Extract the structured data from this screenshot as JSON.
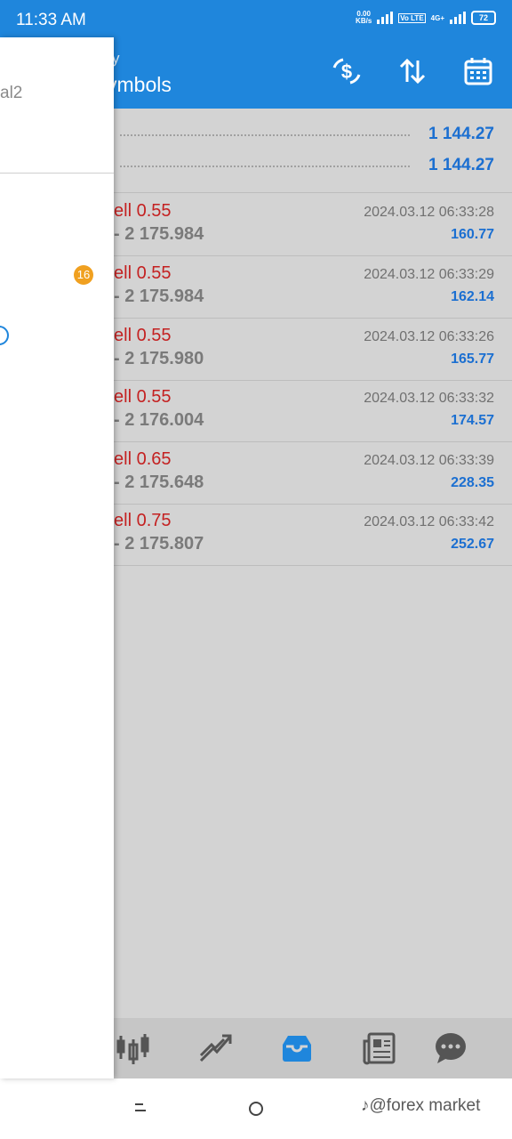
{
  "status_bar": {
    "time": "11:33 AM",
    "net_speed_top": "0.00",
    "net_speed_bottom": "KB/s",
    "network_label": "4G+",
    "volte_label": "Vo LTE",
    "battery": "72"
  },
  "header": {
    "subtitle_fragment": "y",
    "title_fragment": "ymbols",
    "icons": [
      "currency-exchange-icon",
      "sort-icon",
      "calendar-icon"
    ]
  },
  "summary": [
    {
      "value": "1 144.27"
    },
    {
      "value": "1 144.27"
    }
  ],
  "orders": [
    {
      "type": "ell 0.55",
      "price": "- 2 175.984",
      "time": "2024.03.12 06:33:28",
      "profit": "160.77"
    },
    {
      "type": "ell 0.55",
      "price": "- 2 175.984",
      "time": "2024.03.12 06:33:29",
      "profit": "162.14"
    },
    {
      "type": "ell 0.55",
      "price": "- 2 175.980",
      "time": "2024.03.12 06:33:26",
      "profit": "165.77"
    },
    {
      "type": "ell 0.55",
      "price": "- 2 176.004",
      "time": "2024.03.12 06:33:32",
      "profit": "174.57"
    },
    {
      "type": "ell 0.65",
      "price": "- 2 175.648",
      "time": "2024.03.12 06:33:39",
      "profit": "228.35"
    },
    {
      "type": "ell 0.75",
      "price": "- 2 175.807",
      "time": "2024.03.12 06:33:42",
      "profit": "252.67"
    }
  ],
  "drawer": {
    "account_fragment": "al2",
    "badge_count": "16"
  },
  "bottom_nav": [
    "quotes-icon",
    "charts-icon",
    "trade-icon",
    "news-icon",
    "chat-icon"
  ],
  "watermark": "♪@forex market",
  "colors": {
    "accent": "#1f86dc",
    "sell": "#c42121",
    "profit": "#1b6fd1",
    "badge": "#f0a020"
  }
}
